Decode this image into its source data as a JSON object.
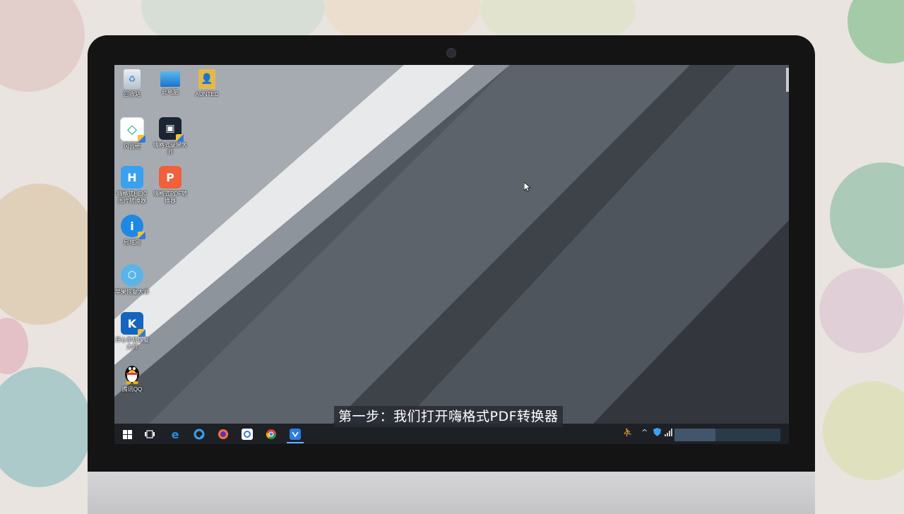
{
  "desktop": {
    "icons": [
      {
        "label": "回收站",
        "icon": "recycle-bin-icon"
      },
      {
        "label": "此电脑",
        "icon": "computer-icon"
      },
      {
        "label": "AUNTEC",
        "icon": "user-folder-icon"
      },
      {
        "label": "风云壁",
        "icon": "fengyun-icon"
      },
      {
        "label": "嗨格式录屏大师",
        "icon": "screen-recorder-icon"
      },
      {
        "label": "嗨格式HEIC图片转换器",
        "icon": "heic-converter-icon"
      },
      {
        "label": "嗨格式PDF转换器",
        "icon": "pdf-converter-icon"
      },
      {
        "label": "局域网",
        "icon": "info-icon"
      },
      {
        "label": "苹果恢复大师",
        "icon": "apple-recovery-icon"
      },
      {
        "label": "开心手机恢复大师",
        "icon": "phone-recovery-icon"
      },
      {
        "label": "腾讯QQ",
        "icon": "qq-penguin-icon"
      }
    ]
  },
  "subtitle": "第一步：我们打开嗨格式PDF转换器",
  "taskbar": {
    "items": [
      "windows-start-icon",
      "task-view-icon",
      "edge-icon",
      "browser-q-icon",
      "firefox-icon",
      "app-cloud-icon",
      "chrome-icon",
      "pdf-converter-taskbar-icon"
    ],
    "tray": [
      "people-icon",
      "chevron-up-icon",
      "shield-tray-icon",
      "network-icon"
    ]
  },
  "colors": {
    "taskbar": "#1d2126",
    "accent": "#2c7be5",
    "pdf_icon": "#f0603a"
  }
}
